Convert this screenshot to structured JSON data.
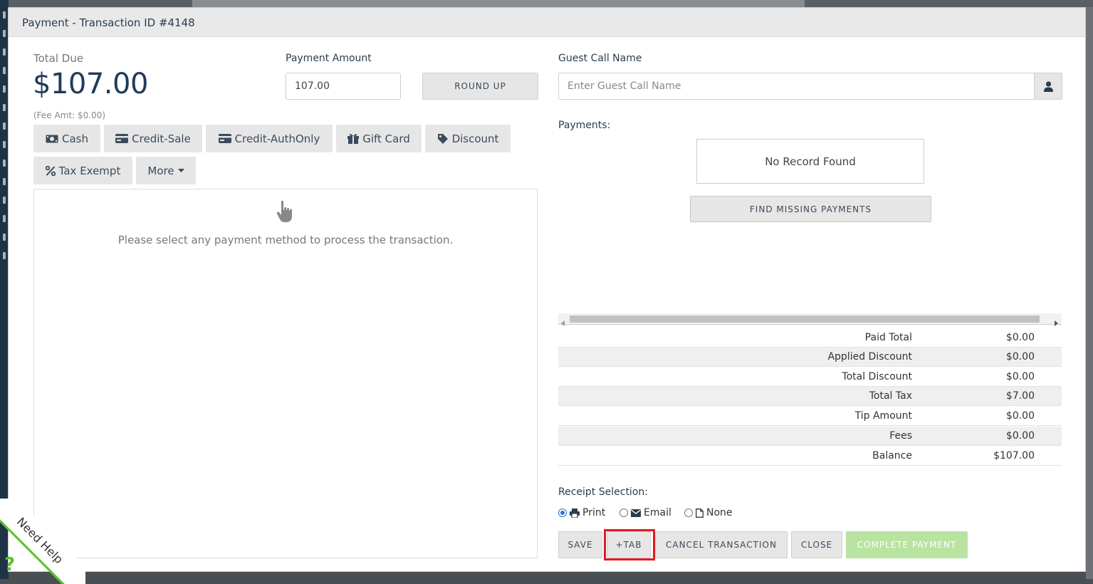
{
  "modal": {
    "title": "Payment - Transaction ID #4148"
  },
  "total_due": {
    "label": "Total Due",
    "amount": "$107.00",
    "fee_note": "(Fee Amt: $0.00)"
  },
  "payment_amount": {
    "label": "Payment Amount",
    "value": "107.00",
    "round_up_label": "ROUND UP"
  },
  "payment_methods": [
    {
      "label": "Cash",
      "icon": "cash-icon"
    },
    {
      "label": "Credit-Sale",
      "icon": "credit-card-icon"
    },
    {
      "label": "Credit-AuthOnly",
      "icon": "credit-card-icon"
    },
    {
      "label": "Gift Card",
      "icon": "gift-icon"
    },
    {
      "label": "Discount",
      "icon": "tag-icon"
    },
    {
      "label": "Tax Exempt",
      "icon": "percent-icon"
    },
    {
      "label": "More",
      "icon": "caret-down-icon"
    }
  ],
  "method_panel": {
    "hint": "Please select any payment method to process the transaction."
  },
  "guest": {
    "label": "Guest Call Name",
    "placeholder": "Enter Guest Call Name"
  },
  "payments": {
    "label": "Payments:",
    "empty_text": "No Record Found",
    "find_missing_label": "FIND MISSING PAYMENTS"
  },
  "totals": [
    {
      "label": "Paid Total",
      "value": "$0.00"
    },
    {
      "label": "Applied Discount",
      "value": "$0.00"
    },
    {
      "label": "Total Discount",
      "value": "$0.00"
    },
    {
      "label": "Total Tax",
      "value": "$7.00"
    },
    {
      "label": "Tip Amount",
      "value": "$0.00"
    },
    {
      "label": "Fees",
      "value": "$0.00"
    },
    {
      "label": "Balance",
      "value": "$107.00"
    }
  ],
  "receipt": {
    "label": "Receipt Selection:",
    "options": [
      {
        "label": "Print",
        "icon": "printer-icon",
        "selected": true
      },
      {
        "label": "Email",
        "icon": "envelope-icon",
        "selected": false
      },
      {
        "label": "None",
        "icon": "file-icon",
        "selected": false
      }
    ]
  },
  "footer": {
    "save_label": "SAVE",
    "tab_label": "+TAB",
    "cancel_label": "CANCEL TRANSACTION",
    "close_label": "CLOSE",
    "complete_label": "COMPLETE PAYMENT"
  },
  "help_widget": {
    "label": "Need Help",
    "symbol": "?"
  },
  "colors": {
    "accent_red": "#e01b24",
    "complete_green": "#b9e3a1",
    "heading_navy": "#1f3b5a"
  }
}
